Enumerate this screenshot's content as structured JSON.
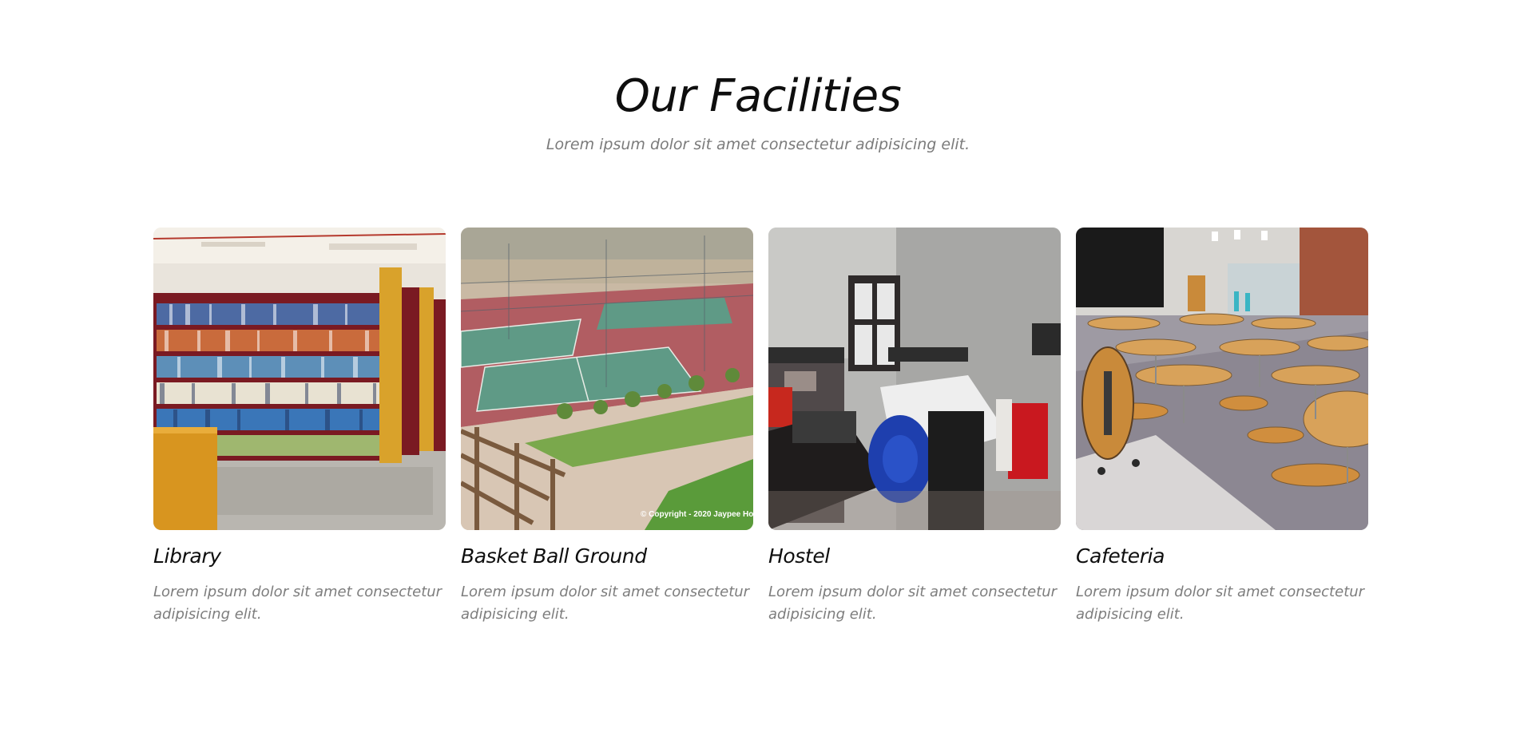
{
  "section": {
    "title": "Our Facilities",
    "subtitle": "Lorem ipsum dolor sit amet consectetur adipisicing elit."
  },
  "facilities": [
    {
      "title": "Library",
      "description": "Lorem ipsum dolor sit amet consectetur adipisicing elit.",
      "image": "library-photo"
    },
    {
      "title": "Basket Ball Ground",
      "description": "Lorem ipsum dolor sit amet consectetur adipisicing elit.",
      "image": "sports-courts-photo",
      "watermark": "© Copyright - 2020 Jaypee Ho"
    },
    {
      "title": "Hostel",
      "description": "Lorem ipsum dolor sit amet consectetur adipisicing elit.",
      "image": "hostel-room-photo"
    },
    {
      "title": "Cafeteria",
      "description": "Lorem ipsum dolor sit amet consectetur adipisicing elit.",
      "image": "cafeteria-photo"
    }
  ],
  "colors": {
    "heading": "#0e0e0e",
    "muted_text": "#7b7b7b",
    "background": "#ffffff"
  }
}
